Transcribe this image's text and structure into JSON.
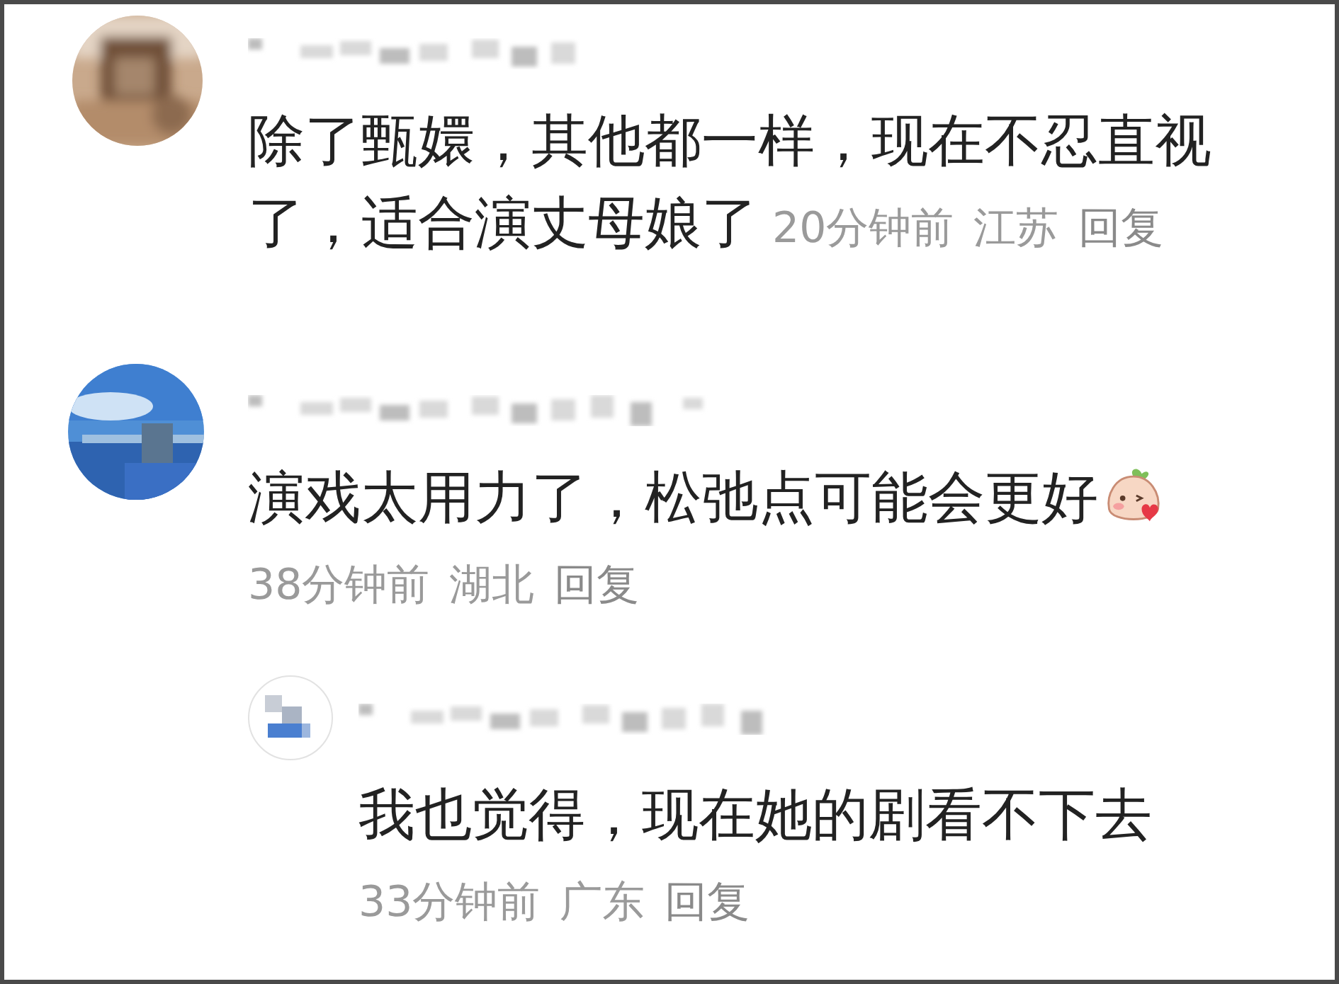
{
  "comments": [
    {
      "text": "除了甄嬛，其他都一样，现在不忍直视了，适合演丈母娘了",
      "time": "20分钟前",
      "location": "江苏",
      "reply_label": "回复"
    },
    {
      "text": "演戏太用力了，松弛点可能会更好",
      "time": "38分钟前",
      "location": "湖北",
      "reply_label": "回复",
      "replies": [
        {
          "text": "我也觉得，现在她的剧看不下去",
          "time": "33分钟前",
          "location": "广东",
          "reply_label": "回复"
        }
      ]
    }
  ]
}
